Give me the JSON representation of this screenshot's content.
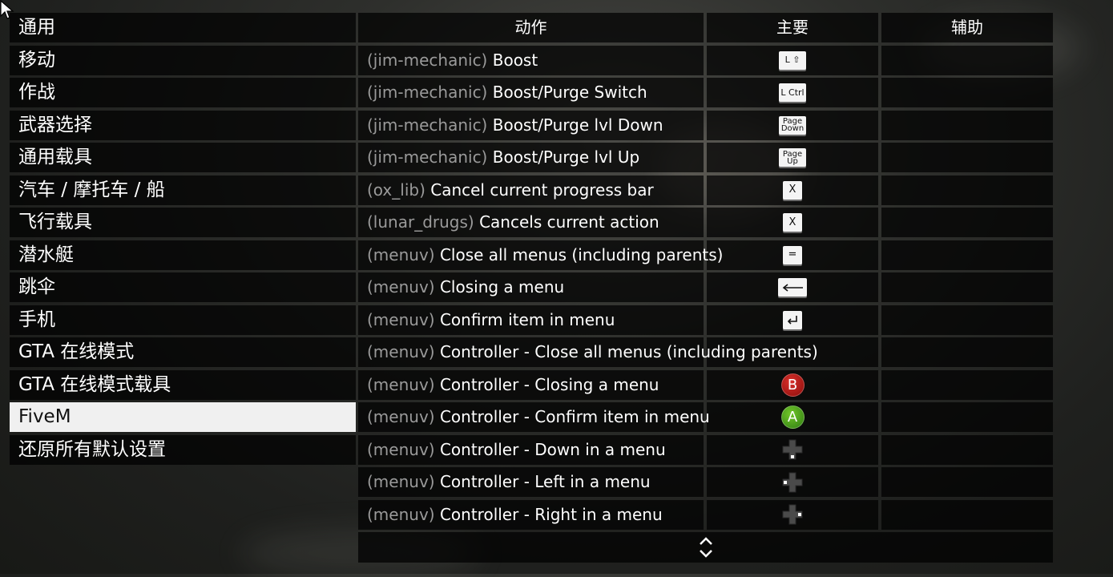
{
  "categories": [
    {
      "label": "通用"
    },
    {
      "label": "移动"
    },
    {
      "label": "作战"
    },
    {
      "label": "武器选择"
    },
    {
      "label": "通用载具"
    },
    {
      "label": "汽车 / 摩托车 / 船"
    },
    {
      "label": "飞行载具"
    },
    {
      "label": "潜水艇"
    },
    {
      "label": "跳伞"
    },
    {
      "label": "手机"
    },
    {
      "label": "GTA 在线模式"
    },
    {
      "label": "GTA 在线模式载具"
    },
    {
      "label": "FiveM",
      "selected": true
    },
    {
      "label": "还原所有默认设置"
    }
  ],
  "header": {
    "action": "动作",
    "primary": "主要",
    "secondary": "辅助"
  },
  "bindings": [
    {
      "resource": "(jim-mechanic)",
      "action": "Boost",
      "primary": {
        "type": "key",
        "label": "L ⇧",
        "icon": "shift-key-icon"
      }
    },
    {
      "resource": "(jim-mechanic)",
      "action": "Boost/Purge Switch",
      "primary": {
        "type": "key",
        "label": "L Ctrl",
        "icon": "ctrl-key-icon"
      }
    },
    {
      "resource": "(jim-mechanic)",
      "action": "Boost/Purge lvl Down",
      "primary": {
        "type": "key2",
        "line1": "Page",
        "line2": "Down",
        "icon": "page-down-key-icon"
      }
    },
    {
      "resource": "(jim-mechanic)",
      "action": "Boost/Purge lvl Up",
      "primary": {
        "type": "key2",
        "line1": "Page",
        "line2": "Up",
        "icon": "page-up-key-icon"
      }
    },
    {
      "resource": "(ox_lib)",
      "action": "Cancel current progress bar",
      "primary": {
        "type": "key",
        "label": "X",
        "icon": "x-key-icon"
      }
    },
    {
      "resource": "(lunar_drugs)",
      "action": "Cancels current action",
      "primary": {
        "type": "key",
        "label": "X",
        "icon": "x-key-icon"
      }
    },
    {
      "resource": "(menuv)",
      "action": "Close all menus (including parents)",
      "primary": {
        "type": "key",
        "label": "=",
        "icon": "equals-key-icon"
      }
    },
    {
      "resource": "(menuv)",
      "action": "Closing a menu",
      "primary": {
        "type": "backspace",
        "icon": "backspace-key-icon"
      }
    },
    {
      "resource": "(menuv)",
      "action": "Confirm item in menu",
      "primary": {
        "type": "enter",
        "icon": "enter-key-icon"
      }
    },
    {
      "resource": "(menuv)",
      "action": "Controller - Close all menus (including parents)",
      "primary": {
        "type": "none"
      }
    },
    {
      "resource": "(menuv)",
      "action": "Controller - Closing a menu",
      "primary": {
        "type": "pad",
        "label": "B",
        "color": "#c4201c",
        "icon": "gamepad-b-button-icon"
      }
    },
    {
      "resource": "(menuv)",
      "action": "Controller - Confirm item in menu",
      "primary": {
        "type": "pad",
        "label": "A",
        "color": "#4faa1e",
        "icon": "gamepad-a-button-icon"
      }
    },
    {
      "resource": "(menuv)",
      "action": "Controller - Down in a menu",
      "primary": {
        "type": "dpad",
        "dir": "down",
        "icon": "dpad-down-icon"
      }
    },
    {
      "resource": "(menuv)",
      "action": "Controller - Left in a menu",
      "primary": {
        "type": "dpad",
        "dir": "left",
        "icon": "dpad-left-icon"
      }
    },
    {
      "resource": "(menuv)",
      "action": "Controller - Right in a menu",
      "primary": {
        "type": "dpad",
        "dir": "right",
        "icon": "dpad-right-icon"
      }
    }
  ],
  "scroll": {
    "icon": "scroll-up-down-icon"
  }
}
